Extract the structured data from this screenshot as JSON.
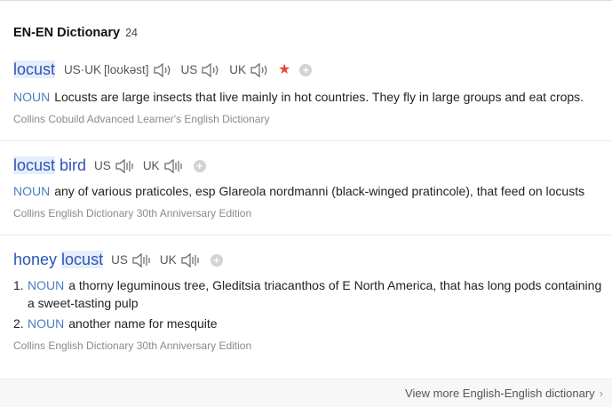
{
  "header": {
    "title": "EN-EN Dictionary",
    "count": "24"
  },
  "entries": [
    {
      "word_parts": [
        "locust"
      ],
      "pron_us_uk_label": "US·UK",
      "phonetic": "[loʊkəst]",
      "us_label": "US",
      "uk_label": "UK",
      "pos": "NOUN",
      "definition": "Locusts are large insects that live mainly in hot countries. They fly in large groups and eat crops.",
      "source": "Collins Cobuild Advanced Learner's English Dictionary"
    },
    {
      "word_parts": [
        "locust",
        "bird"
      ],
      "us_label": "US",
      "uk_label": "UK",
      "pos": "NOUN",
      "definition": "any of various praticoles, esp Glareola nordmanni (black-winged pratincole), that feed on locusts",
      "source": "Collins English Dictionary 30th Anniversary Edition"
    },
    {
      "word_parts": [
        "honey",
        "locust"
      ],
      "us_label": "US",
      "uk_label": "UK",
      "senses": [
        {
          "num": "1.",
          "pos": "NOUN",
          "line1": "a thorny leguminous tree, Gleditsia triacanthos of E North America, that has long pods containing",
          "line2": "a sweet-tasting pulp"
        },
        {
          "num": "2.",
          "pos": "NOUN",
          "line1": "another name for mesquite"
        }
      ],
      "source": "Collins English Dictionary 30th Anniversary Edition"
    }
  ],
  "footer": {
    "more_label": "View more English-English dictionary"
  },
  "colors": {
    "headword": "#2c54b8",
    "pos": "#4a7fc0",
    "star": "#e84a3a"
  }
}
